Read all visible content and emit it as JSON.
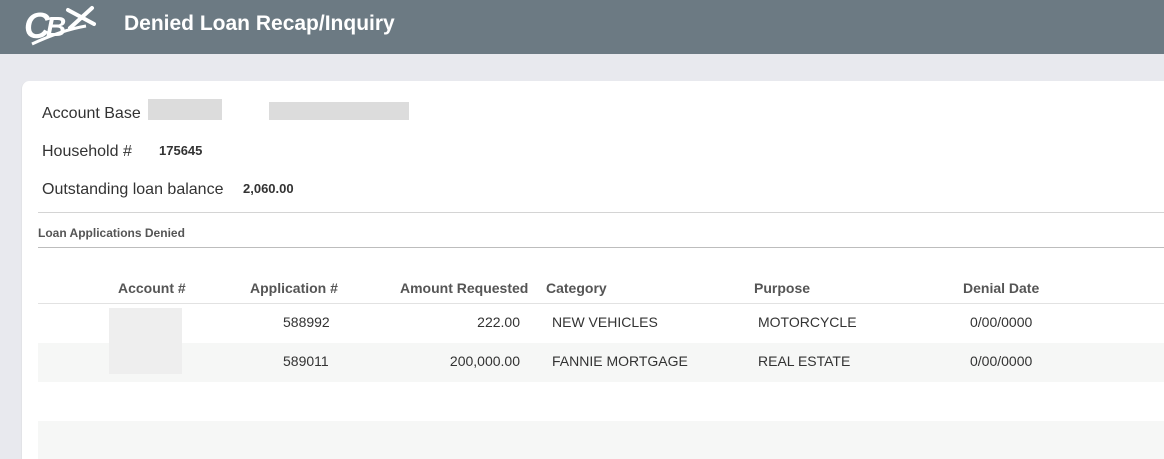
{
  "app": {
    "logo_text": "CBX",
    "title": "Denied Loan Recap/Inquiry"
  },
  "colors": {
    "header_bg": "#6c7a83",
    "page_bg": "#e8e9ee",
    "card_bg": "#ffffff",
    "row_alt_bg": "#f6f7f6"
  },
  "summary": {
    "account_base_label": "Account Base",
    "household_label": "Household #",
    "household_value": "175645",
    "balance_label": "Outstanding loan balance",
    "balance_value": "2,060.00"
  },
  "section": {
    "title": "Loan Applications Denied"
  },
  "table": {
    "columns": [
      "Account #",
      "Application #",
      "Amount Requested",
      "Category",
      "Purpose",
      "Denial Date"
    ],
    "rows": [
      {
        "account": "",
        "application": "588992",
        "amount": "222.00",
        "category": "NEW VEHICLES",
        "purpose": "MOTORCYCLE",
        "denial_date": "0/00/0000"
      },
      {
        "account": "",
        "application": "589011",
        "amount": "200,000.00",
        "category": "FANNIE MORTGAGE",
        "purpose": "REAL ESTATE",
        "denial_date": "0/00/0000"
      }
    ]
  }
}
